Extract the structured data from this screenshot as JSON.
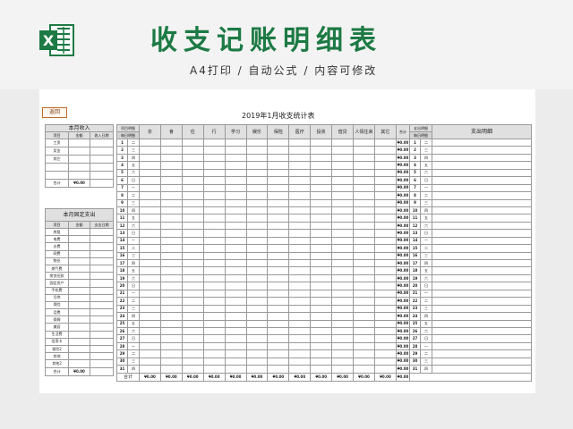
{
  "header": {
    "title": "收支记账明细表",
    "subtitle": "A4打印 / 自动公式 / 内容可修改",
    "icon_color": "#1d7a44"
  },
  "sheet": {
    "return_label": "返回",
    "title": "2019年1月收支统计表"
  },
  "income": {
    "title": "本月收入",
    "headers": [
      "项目",
      "金额",
      "收入日期"
    ],
    "items": [
      "工资",
      "奖金",
      "其它",
      "",
      ""
    ],
    "total_label": "合计",
    "total_value": "¥0.00"
  },
  "fixed": {
    "title": "本月固定支出",
    "headers": [
      "项目",
      "金额",
      "支出日期"
    ],
    "items": [
      "房租",
      "电费",
      "水费",
      "网费",
      "物业",
      "燃气费",
      "房贷还款",
      "固定资产",
      "手机费",
      "月供",
      "保险",
      "话费",
      "保姆",
      "美容",
      "生活费",
      "信用卡",
      "保险2",
      "其他",
      "其他2"
    ],
    "total_label": "合计",
    "total_value": "¥0.00"
  },
  "daily": {
    "date_header": "项目明细",
    "date_subheader": "每日明细",
    "categories": [
      "衣",
      "食",
      "住",
      "行",
      "学习",
      "娱乐",
      "保险",
      "医疗",
      "投资",
      "借贷",
      "人情往来",
      "其它"
    ],
    "sum_header": "合计",
    "right_header": "支出明细",
    "right_subheader": "每日明细",
    "detail_header": "支出明细",
    "days": [
      "1",
      "2",
      "3",
      "4",
      "5",
      "6",
      "7",
      "8",
      "9",
      "10",
      "11",
      "12",
      "13",
      "14",
      "15",
      "16",
      "17",
      "18",
      "19",
      "20",
      "21",
      "22",
      "23",
      "24",
      "25",
      "26",
      "27",
      "28",
      "29",
      "30",
      "31"
    ],
    "weekdays": [
      "二",
      "三",
      "四",
      "五",
      "六",
      "日",
      "一",
      "二",
      "三",
      "四",
      "五",
      "六",
      "日",
      "一",
      "二",
      "三",
      "四",
      "五",
      "六",
      "日",
      "一",
      "二",
      "三",
      "四",
      "五",
      "六",
      "日",
      "一",
      "二",
      "三",
      "四"
    ],
    "row_total": "¥0.00",
    "total_label": "合计",
    "col_totals": [
      "¥0.00",
      "¥0.00",
      "¥0.00",
      "¥0.00",
      "¥0.00",
      "¥0.00",
      "¥0.00",
      "¥0.00",
      "¥0.00",
      "¥0.00",
      "¥0.00",
      "¥0.00",
      "¥0.00"
    ]
  }
}
